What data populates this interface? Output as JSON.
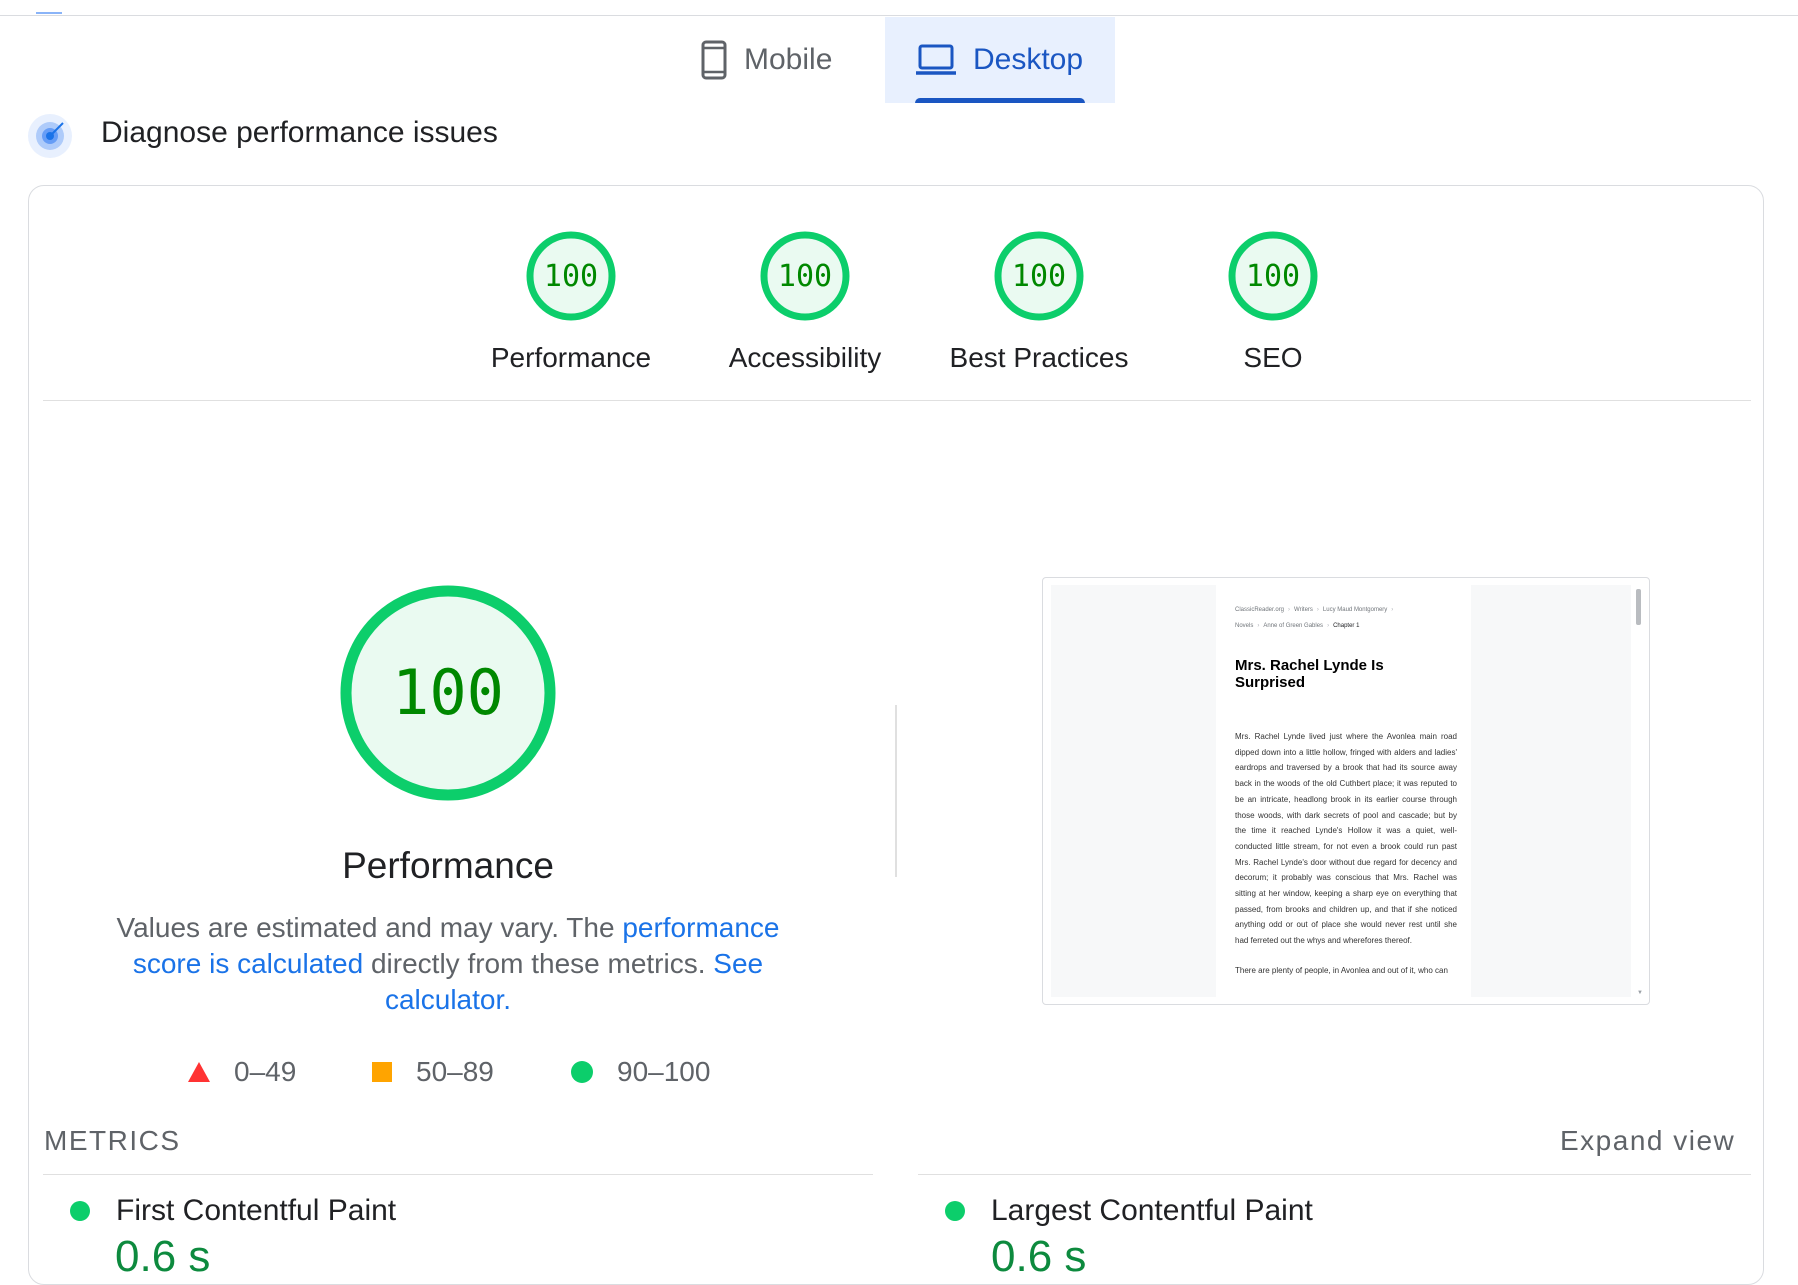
{
  "tabs": [
    {
      "label": "Mobile",
      "icon": "smartphone-icon",
      "selected": false
    },
    {
      "label": "Desktop",
      "icon": "laptop-icon",
      "selected": true
    }
  ],
  "diagnose": {
    "title": "Diagnose performance issues",
    "icon": "radar-icon"
  },
  "categories": [
    {
      "label": "Performance",
      "score": "100"
    },
    {
      "label": "Accessibility",
      "score": "100"
    },
    {
      "label": "Best Practices",
      "score": "100"
    },
    {
      "label": "SEO",
      "score": "100"
    }
  ],
  "performance": {
    "score": "100",
    "title": "Performance",
    "desc_text1": "Values are estimated and may vary. The ",
    "desc_link1": "performance score is calculated",
    "desc_text2": " directly from these metrics. ",
    "desc_link2": "See calculator."
  },
  "legend": [
    {
      "range": "0–49",
      "shape": "triangle",
      "color": "#ff3333"
    },
    {
      "range": "50–89",
      "shape": "square",
      "color": "#ffa400"
    },
    {
      "range": "90–100",
      "shape": "circle",
      "color": "#0cce6b"
    }
  ],
  "screenshot": {
    "breadcrumbs": [
      "ClassicReader.org",
      "Writers",
      "Lucy Maud Montgomery",
      "Novels",
      "Anne of Green Gables",
      "Chapter 1"
    ],
    "heading": "Mrs. Rachel Lynde Is Surprised",
    "paragraph": "Mrs. Rachel Lynde lived just where the Avonlea main road dipped down into a little hollow, fringed with alders and ladies' eardrops and traversed by a brook that had its source away back in the woods of the old Cuthbert place; it was reputed to be an intricate, headlong brook in its earlier course through those woods, with dark secrets of pool and cascade; but by the time it reached Lynde's Hollow it was a quiet, well-conducted little stream, for not even a brook could run past Mrs. Rachel Lynde's door without due regard for decency and decorum; it probably was conscious that Mrs. Rachel was sitting at her window, keeping a sharp eye on everything that passed, from brooks and children up, and that if she noticed anything odd or out of place she would never rest until she had ferreted out the whys and wherefores thereof.",
    "paragraph2": "There are plenty of people, in Avonlea and out of it, who can"
  },
  "metrics": {
    "title": "METRICS",
    "expand_label": "Expand view",
    "items": [
      {
        "name": "First Contentful Paint",
        "value": "0.6 s"
      },
      {
        "name": "Largest Contentful Paint",
        "value": "0.6 s"
      }
    ]
  },
  "colors": {
    "pass": "#0cce6b",
    "pass_fill": "#eafaf1",
    "pass_text": "#008800",
    "accent": "#1a56c2",
    "link": "#1a73e8"
  }
}
